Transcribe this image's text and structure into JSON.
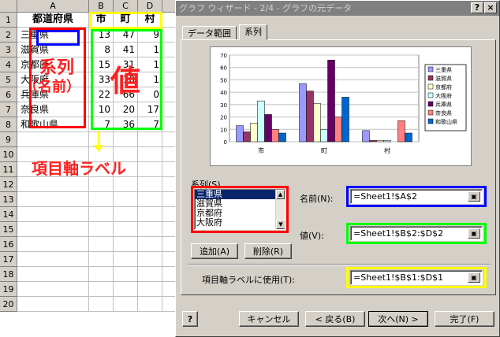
{
  "sheet": {
    "columns": [
      "A",
      "B",
      "C",
      "D"
    ],
    "rows": [
      "1",
      "2",
      "3",
      "4",
      "5",
      "6",
      "7",
      "8",
      "9",
      "10",
      "11",
      "12",
      "13",
      "14",
      "15",
      "16",
      "17",
      "18",
      "19",
      "20"
    ],
    "header_row": [
      "都道府県",
      "市",
      "町",
      "村"
    ],
    "data_rows": [
      [
        "三重県",
        "13",
        "47",
        "9"
      ],
      [
        "滋賀県",
        "8",
        "41",
        "1"
      ],
      [
        "京都府",
        "15",
        "31",
        "1"
      ],
      [
        "大阪府",
        "33",
        "10",
        "1"
      ],
      [
        "兵庫県",
        "22",
        "66",
        "0"
      ],
      [
        "奈良県",
        "10",
        "20",
        "17"
      ],
      [
        "和歌山県",
        "7",
        "36",
        "7"
      ]
    ]
  },
  "annotations": {
    "series_label": "系列",
    "name_label": "（名前）",
    "values_label": "値",
    "axis_label": "項目軸ラベル"
  },
  "dialog": {
    "title": "グラフ ウィザード - 2/4 - グラフの元データ",
    "help_btn": "?",
    "close_btn": "×",
    "tabs": [
      "データ範囲",
      "系列"
    ],
    "series_section": "系列(S)",
    "series_list": [
      "三重県",
      "滋賀県",
      "京都府",
      "大阪府"
    ],
    "name_label": "名前(N):",
    "name_value": "=Sheet1!$A$2",
    "values_label": "値(V):",
    "values_value": "=Sheet1!$B$2:$D$2",
    "add_btn": "追加(A)",
    "delete_btn": "削除(R)",
    "axis_label": "項目軸ラベルに使用(T):",
    "axis_value": "=Sheet1!$B$1:$D$1",
    "cancel_btn": "キャンセル",
    "back_btn": "< 戻る(B)",
    "next_btn": "次へ(N) >",
    "finish_btn": "完了(F)"
  },
  "colors": {
    "red": "#ff0000",
    "blue": "#0000ff",
    "green": "#00ff00",
    "yellow": "#ffff00",
    "annotation_red": "#ff2020"
  },
  "chart_data": {
    "type": "bar",
    "categories": [
      "市",
      "町",
      "村"
    ],
    "ylim": [
      0,
      70
    ],
    "yticks": [
      "70",
      "60",
      "50",
      "40",
      "30",
      "20",
      "10",
      "0"
    ],
    "legend_position": "right",
    "series": [
      {
        "name": "三重県",
        "values": [
          13,
          47,
          9
        ],
        "color": "#9999ff"
      },
      {
        "name": "滋賀県",
        "values": [
          8,
          41,
          1
        ],
        "color": "#993366"
      },
      {
        "name": "京都府",
        "values": [
          15,
          31,
          1
        ],
        "color": "#ffffcc"
      },
      {
        "name": "大阪府",
        "values": [
          33,
          10,
          1
        ],
        "color": "#ccffff"
      },
      {
        "name": "兵庫県",
        "values": [
          22,
          66,
          0
        ],
        "color": "#660066"
      },
      {
        "name": "奈良県",
        "values": [
          10,
          20,
          17
        ],
        "color": "#ff8080"
      },
      {
        "name": "和歌山県",
        "values": [
          7,
          36,
          7
        ],
        "color": "#0066cc"
      }
    ]
  }
}
